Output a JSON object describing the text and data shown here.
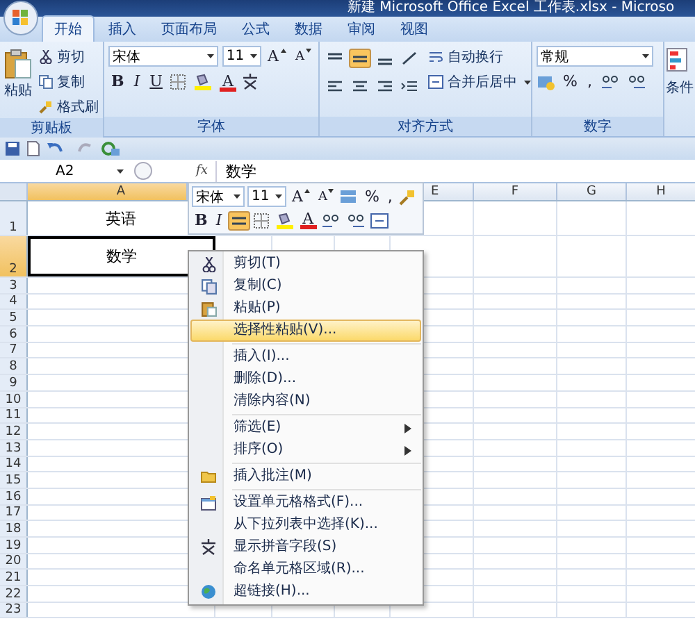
{
  "window": {
    "title": "新建 Microsoft Office Excel 工作表.xlsx - Microso"
  },
  "ribbon_tabs": [
    {
      "label": "开始",
      "selected": true
    },
    {
      "label": "插入",
      "selected": false
    },
    {
      "label": "页面布局",
      "selected": false
    },
    {
      "label": "公式",
      "selected": false
    },
    {
      "label": "数据",
      "selected": false
    },
    {
      "label": "审阅",
      "selected": false
    },
    {
      "label": "视图",
      "selected": false
    }
  ],
  "clipboard": {
    "title": "剪贴板",
    "paste": "粘贴",
    "items": [
      "剪切",
      "复制",
      "格式刷"
    ]
  },
  "font": {
    "title": "字体",
    "font_name": "宋体",
    "font_size": "11",
    "grow": "A",
    "shrink": "A",
    "styles": [
      "B",
      "I",
      "U"
    ],
    "color_letter": "A"
  },
  "alignment": {
    "title": "对齐方式",
    "wrap_text": "自动换行",
    "merge": "合并后居中",
    "center_selected": true
  },
  "number": {
    "title": "数字",
    "format": "常规",
    "percent": "%",
    "comma": ","
  },
  "styles": {
    "label": "条件"
  },
  "formula_bar": {
    "name_box": "A2",
    "fx": "fx",
    "value": "数学"
  },
  "columns": [
    {
      "label": "A",
      "selected": true
    },
    {
      "label": "E",
      "selected": false
    },
    {
      "label": "F",
      "selected": false
    },
    {
      "label": "G",
      "selected": false
    },
    {
      "label": "H",
      "selected": false
    }
  ],
  "rows": [
    {
      "number": "1",
      "selected": false,
      "cells": [
        "英语"
      ]
    },
    {
      "number": "2",
      "selected": true,
      "cells": [
        "数学"
      ]
    },
    {
      "number": "3",
      "selected": false,
      "cells": []
    },
    {
      "number": "4",
      "selected": false,
      "cells": []
    },
    {
      "number": "5",
      "selected": false,
      "cells": []
    },
    {
      "number": "6",
      "selected": false,
      "cells": []
    },
    {
      "number": "7",
      "selected": false,
      "cells": []
    },
    {
      "number": "8",
      "selected": false,
      "cells": []
    },
    {
      "number": "9",
      "selected": false,
      "cells": []
    },
    {
      "number": "10",
      "selected": false,
      "cells": []
    },
    {
      "number": "11",
      "selected": false,
      "cells": []
    },
    {
      "number": "12",
      "selected": false,
      "cells": []
    },
    {
      "number": "13",
      "selected": false,
      "cells": []
    },
    {
      "number": "14",
      "selected": false,
      "cells": []
    },
    {
      "number": "15",
      "selected": false,
      "cells": []
    },
    {
      "number": "16",
      "selected": false,
      "cells": []
    },
    {
      "number": "17",
      "selected": false,
      "cells": []
    },
    {
      "number": "18",
      "selected": false,
      "cells": []
    },
    {
      "number": "19",
      "selected": false,
      "cells": []
    },
    {
      "number": "20",
      "selected": false,
      "cells": []
    },
    {
      "number": "21",
      "selected": false,
      "cells": []
    },
    {
      "number": "22",
      "selected": false,
      "cells": []
    },
    {
      "number": "23",
      "selected": false,
      "cells": []
    }
  ],
  "mini_toolbar": {
    "font_name": "宋体",
    "font_size": "11",
    "grow": "A",
    "shrink": "A",
    "percent": "%",
    "comma": ",",
    "bold": "B",
    "italic": "I",
    "color_letter": "A",
    "center_selected": true
  },
  "context_menu": [
    {
      "kind": "item",
      "label": "剪切(T)",
      "selected": false,
      "submenu": false
    },
    {
      "kind": "item",
      "label": "复制(C)",
      "selected": false,
      "submenu": false
    },
    {
      "kind": "item",
      "label": "粘贴(P)",
      "selected": false,
      "submenu": false
    },
    {
      "kind": "item",
      "label": "选择性粘贴(V)...",
      "selected": true,
      "submenu": false
    },
    {
      "kind": "separator"
    },
    {
      "kind": "item",
      "label": "插入(I)...",
      "selected": false,
      "submenu": false
    },
    {
      "kind": "item",
      "label": "删除(D)...",
      "selected": false,
      "submenu": false
    },
    {
      "kind": "item",
      "label": "清除内容(N)",
      "selected": false,
      "submenu": false
    },
    {
      "kind": "separator"
    },
    {
      "kind": "item",
      "label": "筛选(E)",
      "selected": false,
      "submenu": true
    },
    {
      "kind": "item",
      "label": "排序(O)",
      "selected": false,
      "submenu": true
    },
    {
      "kind": "separator"
    },
    {
      "kind": "item",
      "label": "插入批注(M)",
      "selected": false,
      "submenu": false
    },
    {
      "kind": "separator"
    },
    {
      "kind": "item",
      "label": "设置单元格格式(F)...",
      "selected": false,
      "submenu": false
    },
    {
      "kind": "item",
      "label": "从下拉列表中选择(K)...",
      "selected": false,
      "submenu": false
    },
    {
      "kind": "item",
      "label": "显示拼音字段(S)",
      "selected": false,
      "submenu": false
    },
    {
      "kind": "item",
      "label": "命名单元格区域(R)...",
      "selected": false,
      "submenu": false
    },
    {
      "kind": "item",
      "label": "超链接(H)...",
      "selected": false,
      "submenu": false
    }
  ]
}
